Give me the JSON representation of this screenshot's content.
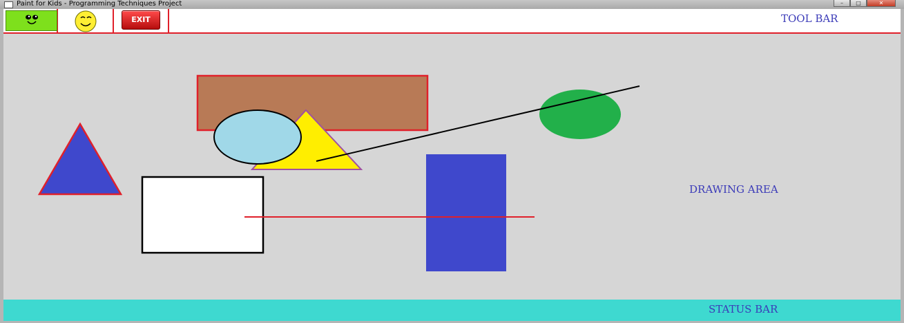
{
  "window": {
    "title": "Paint for Kids - Programming Techniques Project",
    "minimize_glyph": "–",
    "maximize_glyph": "□",
    "close_glyph": "✕"
  },
  "toolbar": {
    "label": "TOOL BAR",
    "items": [
      {
        "name": "happy-face",
        "icon": "green-smiley-icon"
      },
      {
        "name": "sleepy-face",
        "icon": "yellow-smiley-icon"
      },
      {
        "name": "exit",
        "label": "EXIT",
        "icon": "exit-button-icon"
      }
    ]
  },
  "drawing_area": {
    "label": "DRAWING AREA",
    "background": "#d6d6d6",
    "shapes": [
      {
        "type": "rectangle",
        "fill": "#b87a56",
        "stroke": "#e0202a"
      },
      {
        "type": "triangle",
        "fill": "#ffee00",
        "stroke": "#a050a0"
      },
      {
        "type": "ellipse",
        "fill": "#a0d8e8",
        "stroke": "#000000"
      },
      {
        "type": "ellipse",
        "fill": "#22b04a",
        "stroke": "none"
      },
      {
        "type": "line",
        "stroke": "#000000"
      },
      {
        "type": "triangle",
        "fill": "#3f48cc",
        "stroke": "#e0202a"
      },
      {
        "type": "rectangle",
        "fill": "#ffffff",
        "stroke": "#000000"
      },
      {
        "type": "rectangle",
        "fill": "#3f48cc",
        "stroke": "none"
      },
      {
        "type": "line",
        "stroke": "#e0202a"
      }
    ]
  },
  "statusbar": {
    "label": "STATUS BAR",
    "background": "#3ed9d0"
  }
}
